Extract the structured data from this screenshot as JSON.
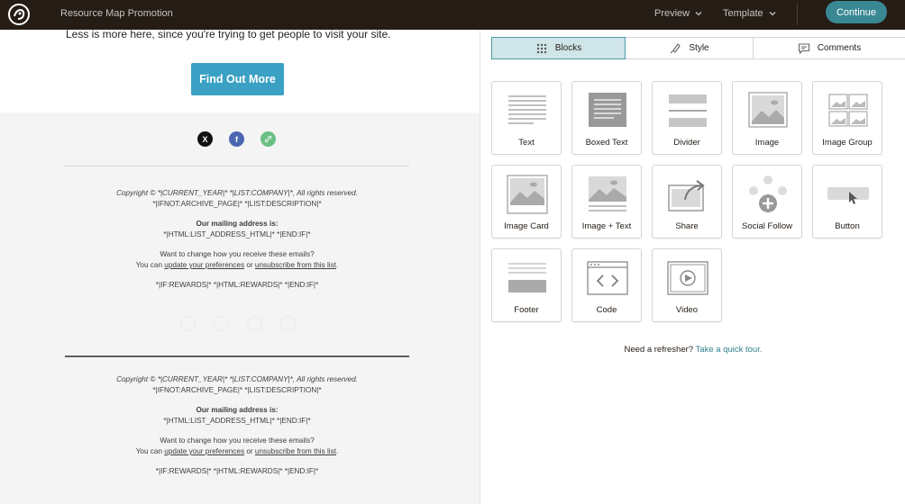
{
  "topbar": {
    "title": "Resource Map Promotion",
    "preview_label": "Preview",
    "template_label": "Template",
    "continue_label": "Continue"
  },
  "email": {
    "intro": "Less is more here, since you're trying to get people to visit your site.",
    "cta_label": "Find Out More",
    "social": [
      "x-icon",
      "facebook-icon",
      "link-icon"
    ],
    "footers": [
      {
        "copyright": "Copyright © *|CURRENT_YEAR|* *|LIST:COMPANY|*, All rights reserved.",
        "archive": "*|IFNOT:ARCHIVE_PAGE|* *|LIST:DESCRIPTION|*",
        "address_heading": "Our mailing address is:",
        "address": "*|HTML:LIST_ADDRESS_HTML|* *|END:IF|*",
        "change": "Want to change how you receive these emails?",
        "you_can": "You can",
        "update_link": "update your preferences",
        "or": "or",
        "unsub_link": "unsubscribe from this list",
        "period": ".",
        "rewards": "*|IF:REWARDS|* *|HTML:REWARDS|* *|END:IF|*"
      },
      {
        "copyright": "Copyright © *|CURRENT_YEAR|* *|LIST:COMPANY|*, All rights reserved.",
        "archive": "*|IFNOT:ARCHIVE_PAGE|* *|LIST:DESCRIPTION|*",
        "address_heading": "Our mailing address is:",
        "address": "*|HTML:LIST_ADDRESS_HTML|* *|END:IF|*",
        "change": "Want to change how you receive these emails?",
        "you_can": "You can",
        "update_link": "update your preferences",
        "or": "or",
        "unsub_link": "unsubscribe from this list",
        "period": ".",
        "rewards": "*|IF:REWARDS|* *|HTML:REWARDS|* *|END:IF|*"
      }
    ]
  },
  "panel": {
    "tabs": [
      {
        "label": "Blocks",
        "icon": "grid-dots-icon",
        "active": true
      },
      {
        "label": "Style",
        "icon": "paintbrush-icon",
        "active": false
      },
      {
        "label": "Comments",
        "icon": "comment-icon",
        "active": false
      }
    ],
    "blocks": [
      {
        "label": "Text",
        "icon": "text-block-icon"
      },
      {
        "label": "Boxed Text",
        "icon": "boxed-text-icon"
      },
      {
        "label": "Divider",
        "icon": "divider-icon"
      },
      {
        "label": "Image",
        "icon": "image-icon"
      },
      {
        "label": "Image Group",
        "icon": "image-group-icon"
      },
      {
        "label": "Image Card",
        "icon": "image-card-icon"
      },
      {
        "label": "Image + Text",
        "icon": "image-text-icon"
      },
      {
        "label": "Share",
        "icon": "share-icon"
      },
      {
        "label": "Social Follow",
        "icon": "social-follow-icon"
      },
      {
        "label": "Button",
        "icon": "button-block-icon"
      },
      {
        "label": "Footer",
        "icon": "footer-icon"
      },
      {
        "label": "Code",
        "icon": "code-icon"
      },
      {
        "label": "Video",
        "icon": "video-icon"
      }
    ],
    "refresher_text": "Need a refresher?",
    "refresher_link": "Take a quick tour."
  },
  "colors": {
    "topbar_bg": "#241c15",
    "accent": "#3a8893",
    "cta": "#3aa1c4",
    "active_tab": "#cfe5e8"
  }
}
